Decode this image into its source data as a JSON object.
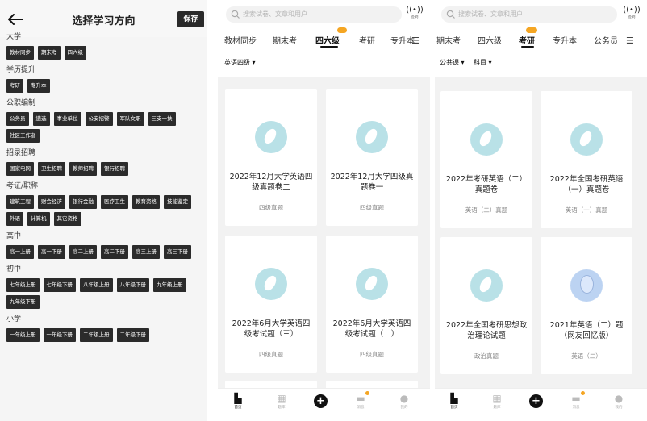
{
  "panel1": {
    "title": "选择学习方向",
    "save_label": "保存",
    "sections": [
      {
        "title": "大学",
        "chips": [
          "教材同步",
          "期末考",
          "四六级"
        ]
      },
      {
        "title": "学历提升",
        "chips": [
          "考研",
          "专升本"
        ]
      },
      {
        "title": "公职编制",
        "chips": [
          "公务员",
          "遴选",
          "事业单位",
          "公安招警",
          "军队文职",
          "三支一扶",
          "社区工作者"
        ]
      },
      {
        "title": "招录招聘",
        "chips": [
          "国家电网",
          "卫生招聘",
          "教师招聘",
          "银行招聘"
        ]
      },
      {
        "title": "考证/职称",
        "chips": [
          "建筑工程",
          "财会经济",
          "银行金融",
          "医疗卫生",
          "教育资格",
          "技能鉴定",
          "外语",
          "计算机",
          "其它资格"
        ]
      },
      {
        "title": "高中",
        "chips": [
          "高一上册",
          "高一下册",
          "高二上册",
          "高二下册",
          "高三上册",
          "高三下册"
        ]
      },
      {
        "title": "初中",
        "chips": [
          "七年级上册",
          "七年级下册",
          "八年级上册",
          "八年级下册",
          "九年级上册",
          "九年级下册"
        ]
      },
      {
        "title": "小学",
        "chips": [
          "一年级上册",
          "一年级下册",
          "二年级上册",
          "二年级下册"
        ]
      }
    ]
  },
  "panel2": {
    "search_placeholder": "搜索试卷、文章和用户",
    "signal_label": "签到",
    "tabs": [
      "教材同步",
      "期末考",
      "四六级",
      "考研",
      "专升本"
    ],
    "active_tab": "四六级",
    "filters": [
      "英语四级"
    ],
    "cards": [
      {
        "title": "2022年12月大学英语四级真题卷二",
        "sub": "四级真题",
        "icon": "ring"
      },
      {
        "title": "2022年12月大学四级真题卷一",
        "sub": "四级真题",
        "icon": "ring"
      },
      {
        "title": "2022年6月大学英语四级考试题（三）",
        "sub": "四级真题",
        "icon": "ring"
      },
      {
        "title": "2022年6月大学英语四级考试题（二）",
        "sub": "四级真题",
        "icon": "ring"
      }
    ],
    "nav": [
      "首页",
      "题库",
      "",
      "消息",
      "我的"
    ]
  },
  "panel3": {
    "search_placeholder": "搜索试卷、文章和用户",
    "signal_label": "签到",
    "tabs": [
      "期末考",
      "四六级",
      "考研",
      "专升本",
      "公务员"
    ],
    "active_tab": "考研",
    "filters": [
      "公共课",
      "科目"
    ],
    "cards": [
      {
        "title": "2022年考研英语（二）真题卷",
        "sub": "英语（二）真题",
        "icon": "ring"
      },
      {
        "title": "2022年全国考研英语（一）真题卷",
        "sub": "英语（一）真题",
        "icon": "ring"
      },
      {
        "title": "2022年全国考研思想政治理论试题",
        "sub": "政治真题",
        "icon": "ring"
      },
      {
        "title": "2021年英语（二）题（网友回忆版）",
        "sub": "英语（二）",
        "icon": "balloon"
      }
    ],
    "nav": [
      "首页",
      "题库",
      "",
      "消息",
      "我的"
    ]
  },
  "colors": {
    "chip_bg": "#2b2b2b",
    "accent": "#f5a623",
    "icon_teal": "#b9e1e7",
    "grid_bg": "#f2f2f2"
  }
}
